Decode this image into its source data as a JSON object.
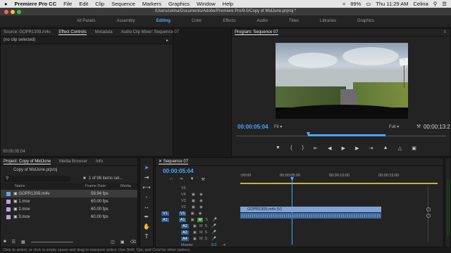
{
  "menubar": {
    "apple": "",
    "app": "Premiere Pro CC",
    "items": [
      "File",
      "Edit",
      "Clip",
      "Sequence",
      "Markers",
      "Graphics",
      "Window",
      "Help"
    ],
    "battery": "89%",
    "clock": "Thu 11:29 AM",
    "user": "Celina"
  },
  "window": {
    "title": "/Users/celina/Documents/Adobe/Premiere Pro/9.0/Copy of MidJune.prproj *"
  },
  "workspaces": {
    "items": [
      "All Panels",
      "Assembly",
      "Editing",
      "Color",
      "Effects",
      "Audio",
      "Titles",
      "Libraries",
      "Graphics"
    ],
    "active": "Editing"
  },
  "source_panel": {
    "tabs": [
      "Source: GOPR1309.m4v",
      "Effect Controls",
      "Metadata",
      "Audio Clip Mixer: Sequence 07"
    ],
    "active_tab": "Effect Controls",
    "message": "(no clip selected)",
    "timecode": "00:00:05:04"
  },
  "program_panel": {
    "tab": "Program: Sequence 07",
    "timecode": "00:00:05:04",
    "fit": "Fit",
    "quality": "Full",
    "duration": "00:00:13:2"
  },
  "project_panel": {
    "tabs": [
      "Project: Copy of MidJune",
      "Media Browser",
      "Info"
    ],
    "filename": "Copy of MidJune.prproj",
    "items_count": "1 of 98 items sel...",
    "columns": [
      "Name",
      "Frame Rate",
      "Media"
    ],
    "rows": [
      {
        "name": "GOPR1309.m4v",
        "rate": "59.94 fps",
        "color": "#5fa8e8"
      },
      {
        "name": "1.mov",
        "rate": "60.00 fps",
        "color": "#b9a2e6"
      },
      {
        "name": "2.mov",
        "rate": "60.00 fps",
        "color": "#b9a2e6"
      },
      {
        "name": "3.mov",
        "rate": "60.00 fps",
        "color": "#b9a2e6"
      }
    ]
  },
  "timeline": {
    "tab": "Sequence 07",
    "timecode": "00:00:05:04",
    "ruler": [
      ":00:00",
      "00:00:05:00",
      "00:00:10:00",
      "00:00:15:00"
    ],
    "video_tracks": [
      "V5",
      "V4",
      "V3",
      "V2",
      "V1"
    ],
    "audio_tracks": [
      "A1",
      "A2",
      "A3",
      "A4"
    ],
    "source_patch_v": "V1",
    "source_patch_a": "A1",
    "master": "Master",
    "master_value": "0.0",
    "clip_label": "GOPR1309.m4v [V]"
  },
  "status": {
    "text": "Click to select, or click in empty space and drag to marquee select. Use Shift, Opt, and Cmd for other options."
  },
  "colors": {
    "accent": "#4da6ff",
    "clip_video": "#7ea3d6",
    "clip_audio": "#3f6aa0"
  }
}
